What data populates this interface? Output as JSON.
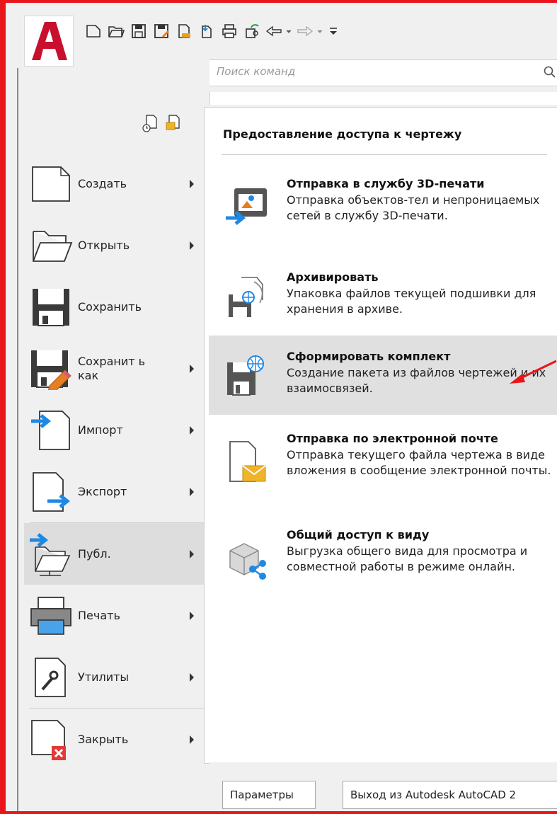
{
  "search": {
    "placeholder": "Поиск команд"
  },
  "qat": {
    "icons": [
      "new-icon",
      "open-icon",
      "save-icon",
      "saveas-icon",
      "import-icon",
      "export-icon",
      "print-icon",
      "share-icon",
      "undo-icon",
      "redo-icon",
      "customize-icon"
    ]
  },
  "menu": {
    "items": [
      {
        "label": "Создать",
        "has_submenu": true
      },
      {
        "label": "Открыть",
        "has_submenu": true
      },
      {
        "label": "Сохранить",
        "has_submenu": false
      },
      {
        "label": "Сохранит ь как",
        "has_submenu": true
      },
      {
        "label": "Импорт",
        "has_submenu": true
      },
      {
        "label": "Экспорт",
        "has_submenu": true
      },
      {
        "label": "Публ.",
        "has_submenu": true,
        "active": true
      },
      {
        "label": "Печать",
        "has_submenu": true
      },
      {
        "label": "Утилиты",
        "has_submenu": true
      },
      {
        "label": "Закрыть",
        "has_submenu": true
      }
    ]
  },
  "submenu": {
    "title": "Предоставление доступа к чертежу",
    "items": [
      {
        "title": "Отправка в службу 3D-печати",
        "desc": "Отправка объектов-тел и непроницаемых сетей в службу 3D-печати."
      },
      {
        "title": "Архивировать",
        "desc": "Упаковка файлов текущей подшивки для хранения в архиве."
      },
      {
        "title": "Сформировать комплект",
        "desc": "Создание пакета из файлов чертежей и их взаимосвязей.",
        "active": true
      },
      {
        "title": "Отправка по электронной почте",
        "desc": "Отправка текущего файла чертежа в виде вложения в сообщение электронной почты."
      },
      {
        "title": "Общий доступ к виду",
        "desc": "Выгрузка общего вида для просмотра и совместной работы в режиме онлайн."
      }
    ]
  },
  "footer": {
    "options_label": "Параметры",
    "exit_label": "Выход из Autodesk AutoCAD 2"
  },
  "colors": {
    "frame": "#e8161b",
    "accent": "#1e88e5",
    "logo": "#c8102e"
  }
}
